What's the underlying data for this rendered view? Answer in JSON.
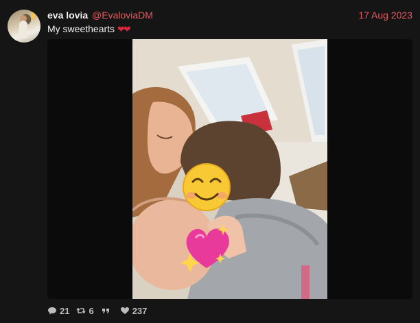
{
  "post": {
    "author_name": "eva lovia",
    "author_handle": "@EvaloviaDM",
    "date": "17 Aug 2023",
    "text": "My sweethearts",
    "emoji": "❤❤",
    "stats": {
      "replies": "21",
      "retweets": "6",
      "quotes": "",
      "likes": "237"
    }
  },
  "icons": {
    "reply": "speech-bubble-icon",
    "retweet": "retweet-icon",
    "quote": "quote-icon",
    "like": "heart-icon"
  },
  "colors": {
    "background": "#151515",
    "accent": "#e8595f",
    "heart": "#d8273a"
  }
}
